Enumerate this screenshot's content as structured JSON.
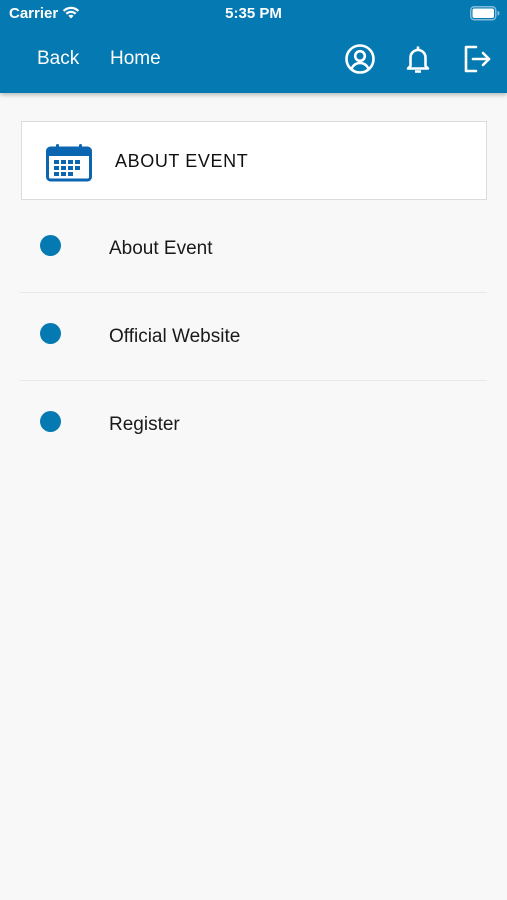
{
  "status_bar": {
    "carrier": "Carrier",
    "time": "5:35 PM",
    "wifi_icon": "wifi-icon",
    "battery_icon": "battery-icon"
  },
  "appbar": {
    "back_label": "Back",
    "home_label": "Home",
    "icons": [
      "profile-icon",
      "bell-icon",
      "logout-icon"
    ],
    "color": "#0579b1"
  },
  "header": {
    "title": "ABOUT EVENT",
    "icon": "calendar-icon"
  },
  "menu": {
    "items": [
      {
        "label": "About Event"
      },
      {
        "label": "Official Website"
      },
      {
        "label": "Register"
      }
    ]
  },
  "colors": {
    "accent": "#0579b1",
    "background": "#f8f8f8"
  }
}
